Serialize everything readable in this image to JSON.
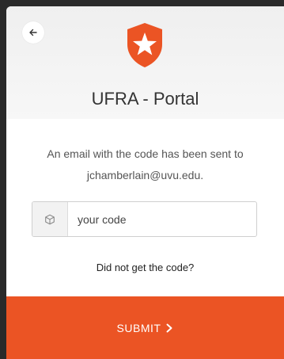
{
  "header": {
    "title": "UFRA - Portal",
    "back_icon": "arrow-left-icon",
    "logo_icon": "shield-star-logo",
    "brand_color": "#eb5424"
  },
  "body": {
    "message": "An email with the code has been sent to jchamberlain@uvu.edu.",
    "code_input": {
      "value": "",
      "placeholder": "your code",
      "icon": "cube-icon"
    },
    "resend_link": "Did not get the code?"
  },
  "footer": {
    "submit_label": "SUBMIT",
    "submit_icon": "chevron-right-icon",
    "submit_color": "#eb5424"
  }
}
